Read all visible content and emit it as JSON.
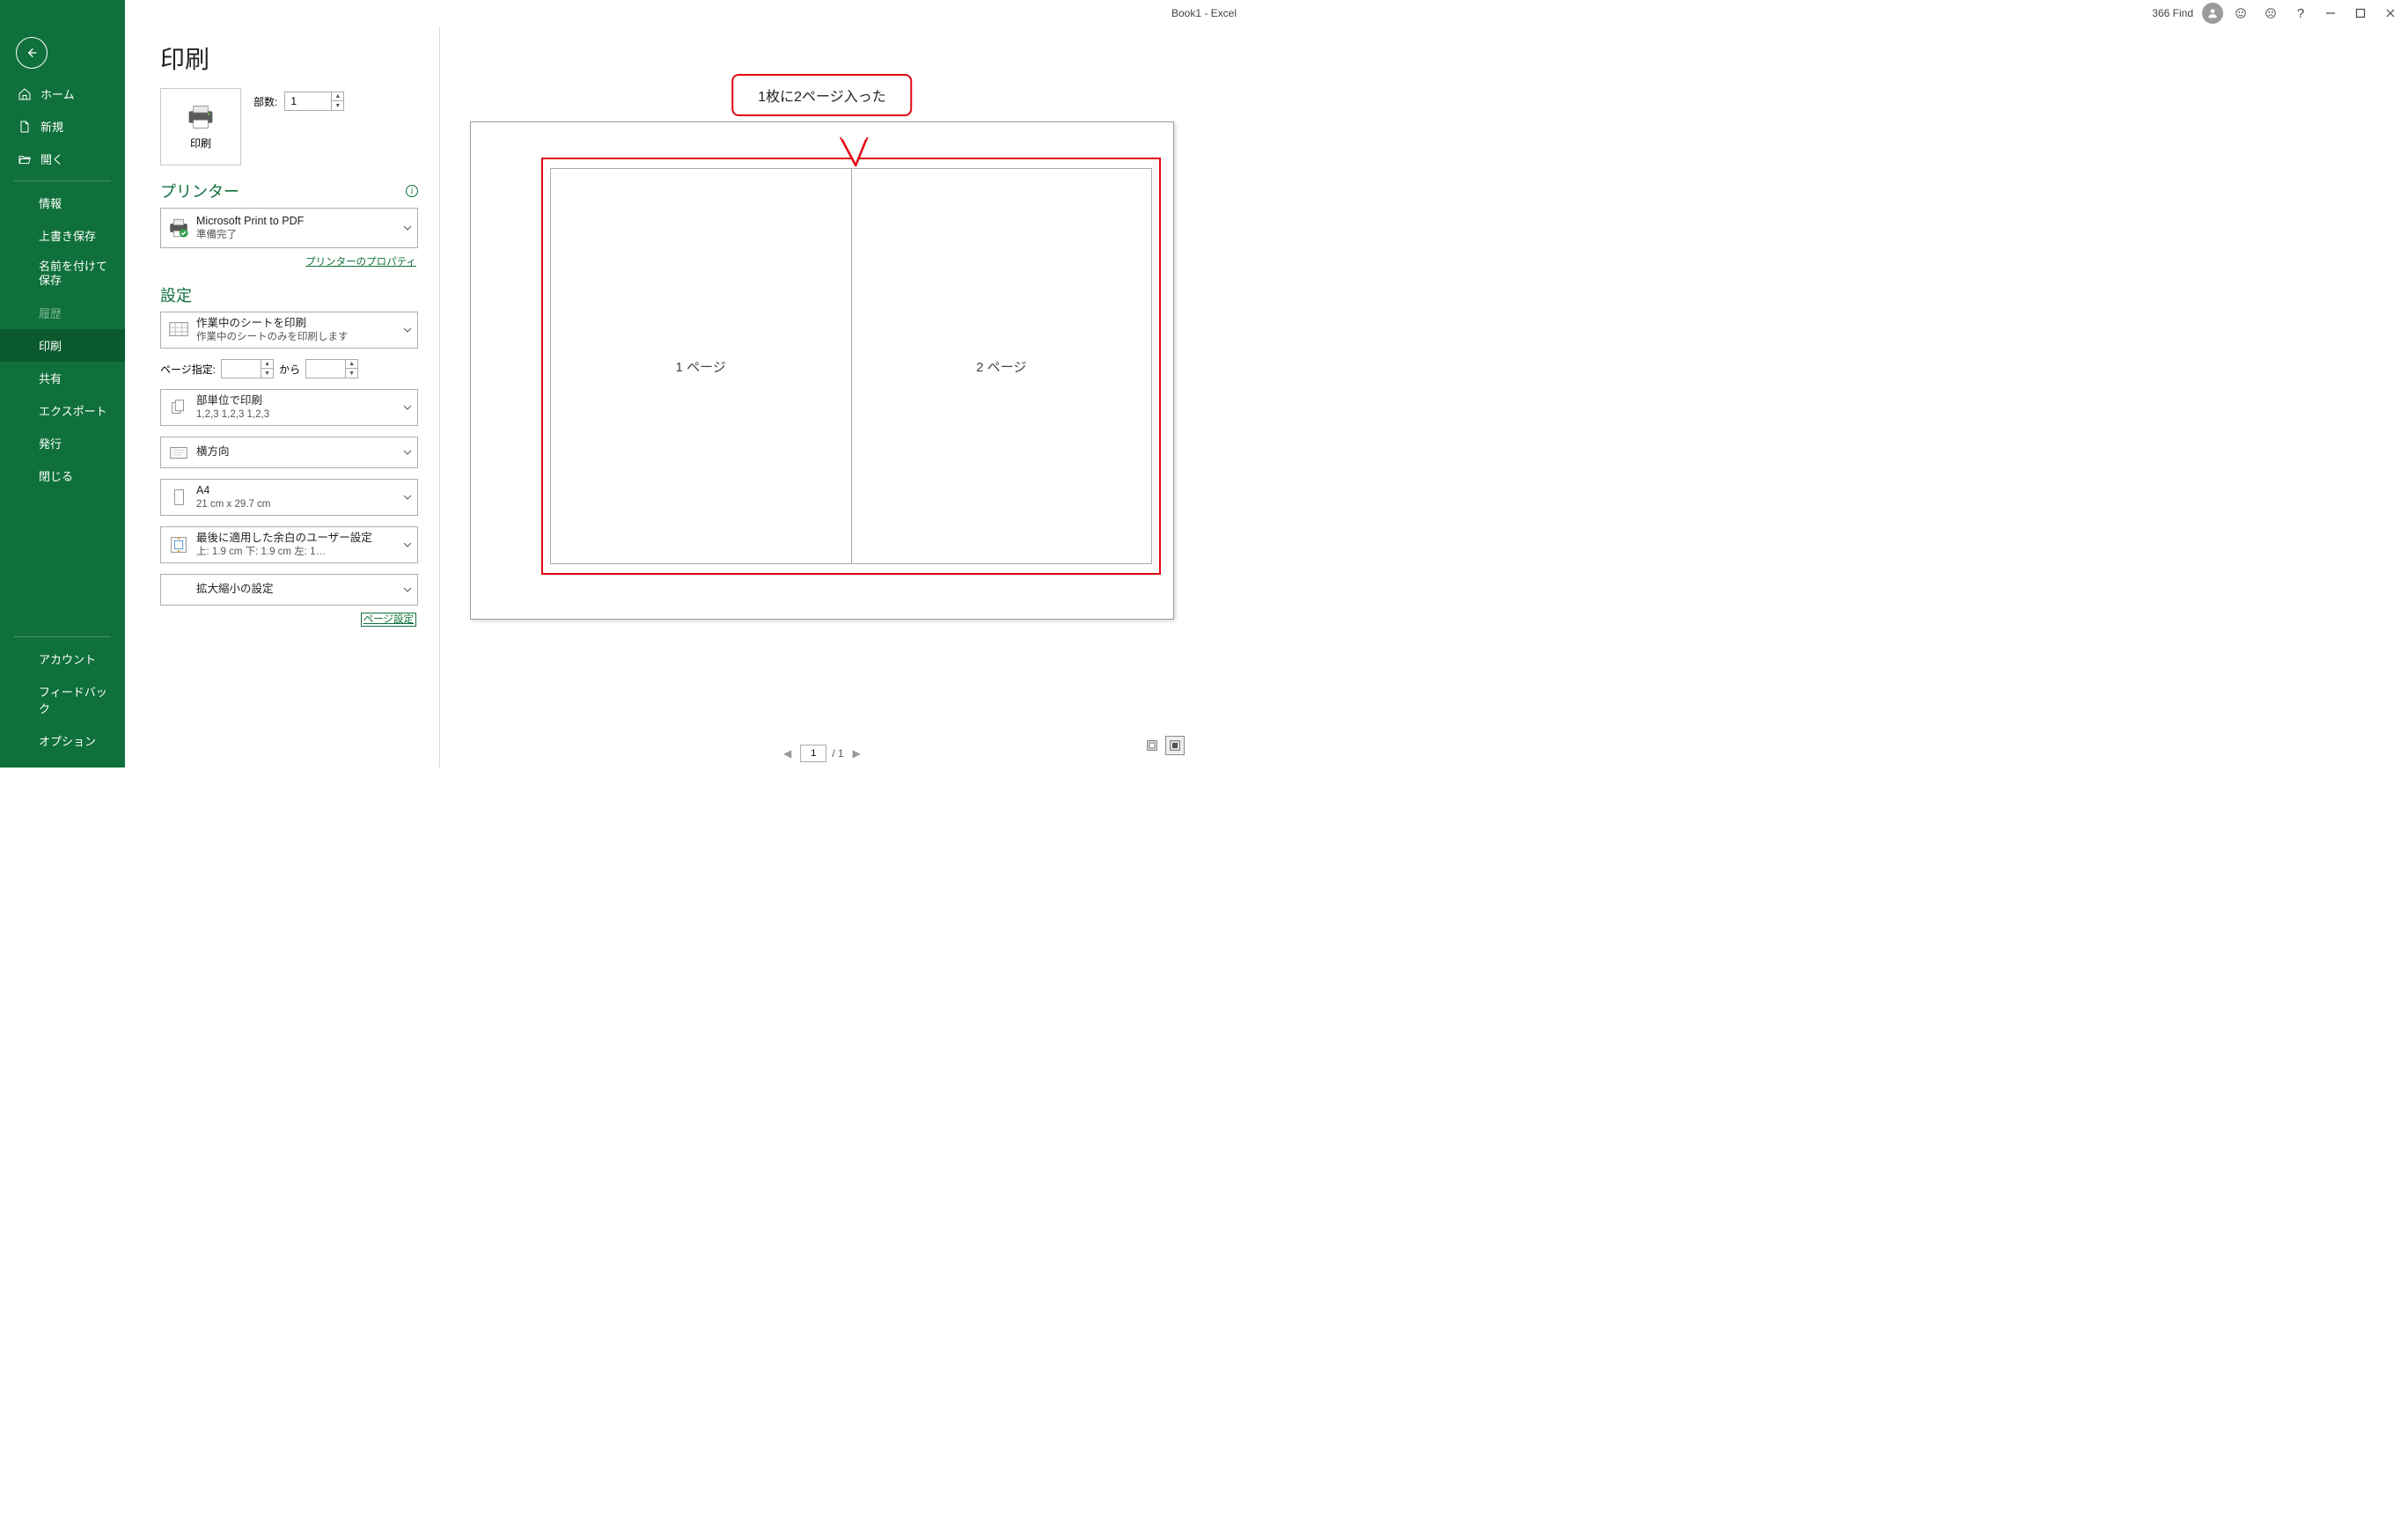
{
  "window": {
    "title": "Book1  -  Excel",
    "user_label": "366 Find"
  },
  "sidebar": {
    "home": "ホーム",
    "new": "新規",
    "open": "開く",
    "info": "情報",
    "save": "上書き保存",
    "saveas": "名前を付けて保存",
    "history": "履歴",
    "print": "印刷",
    "share": "共有",
    "export": "エクスポート",
    "publish": "発行",
    "close": "閉じる",
    "account": "アカウント",
    "feedback": "フィードバック",
    "options": "オプション"
  },
  "print": {
    "heading": "印刷",
    "button": "印刷",
    "copies_label": "部数:",
    "copies_value": "1"
  },
  "printer": {
    "heading": "プリンター",
    "name": "Microsoft Print to PDF",
    "status": "準備完了",
    "properties_link": "プリンターのプロパティ"
  },
  "settings": {
    "heading": "設定",
    "what": {
      "l1": "作業中のシートを印刷",
      "l2": "作業中のシートのみを印刷します"
    },
    "range_label": "ページ指定:",
    "range_from": "",
    "range_sep": "から",
    "range_to": "",
    "collate": {
      "l1": "部単位で印刷",
      "l2": "1,2,3    1,2,3    1,2,3"
    },
    "orientation": {
      "l1": "横方向"
    },
    "paper": {
      "l1": "A4",
      "l2": "21 cm x 29.7 cm"
    },
    "margins": {
      "l1": "最後に適用した余白のユーザー設定",
      "l2": "上: 1.9 cm 下: 1.9 cm 左: 1…"
    },
    "scaling": {
      "l1": "拡大縮小の設定"
    },
    "page_setup_link": "ページ設定"
  },
  "annotation": {
    "text": "1枚に2ページ入った"
  },
  "preview": {
    "page1": "1 ページ",
    "page2": "2 ページ",
    "current_page": "1",
    "total_pages": "/ 1"
  }
}
